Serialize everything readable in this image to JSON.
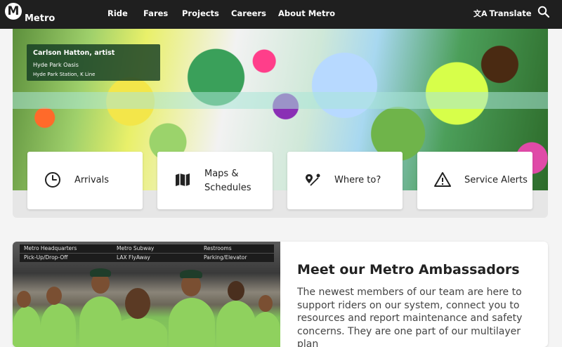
{
  "nav": {
    "logo_text": "Metro",
    "items": [
      "Ride",
      "Fares",
      "Projects",
      "Careers",
      "About Metro"
    ],
    "translate_label": "Translate",
    "translate_icon": "translate-icon",
    "search_icon": "search-icon"
  },
  "hero": {
    "caption": {
      "title": "Carlson Hatton, artist",
      "subtitle": "Hyde Park Oasis",
      "location": "Hyde Park Station, K Line"
    }
  },
  "quick_links": [
    {
      "label": "Arrivals",
      "icon": "clock-icon"
    },
    {
      "label": "Maps & Schedules",
      "icon": "map-icon"
    },
    {
      "label": "Where to?",
      "icon": "route-pin-icon"
    },
    {
      "label": "Service Alerts",
      "icon": "alert-icon"
    }
  ],
  "ambassadors": {
    "title": "Meet our Metro Ambassadors",
    "body": "The newest members of our team are here to support riders on our system, connect you to resources and report maintenance and safety concerns. They are one part of our multilayer plan",
    "signs": {
      "row1": [
        "Metro Headquarters",
        "Metro Subway",
        "Restrooms"
      ],
      "row2": [
        "Pick-Up/Drop-Off",
        "LAX FlyAway",
        "Parking/Elevator"
      ]
    }
  },
  "colors": {
    "nav_bg": "#1f1f1f",
    "page_bg": "#f4f4f4",
    "ambassador_green": "#8fd15e"
  }
}
